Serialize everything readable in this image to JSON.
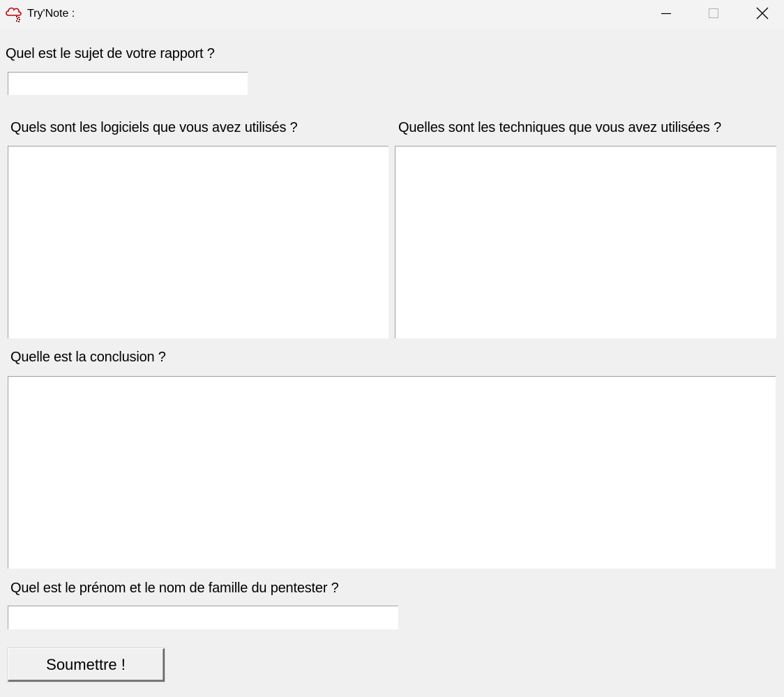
{
  "window": {
    "title": "Try'Note :",
    "controls": {
      "minimize_icon": "minimize-icon",
      "maximize_icon": "maximize-icon",
      "close_icon": "close-icon"
    },
    "app_icon": "cloud-icon",
    "accent_color": "#c00000"
  },
  "form": {
    "subject": {
      "label": "Quel est le sujet de votre rapport ?",
      "value": ""
    },
    "software": {
      "label": "Quels sont les logiciels que vous avez utilisés ?",
      "value": ""
    },
    "techniques": {
      "label": "Quelles sont les techniques que vous avez utilisées ?",
      "value": ""
    },
    "conclusion": {
      "label": "Quelle est la conclusion ?",
      "value": ""
    },
    "pentester": {
      "label": "Quel est le prénom et le nom de famille du pentester ?",
      "value": ""
    },
    "submit_label": "Soumettre !"
  }
}
